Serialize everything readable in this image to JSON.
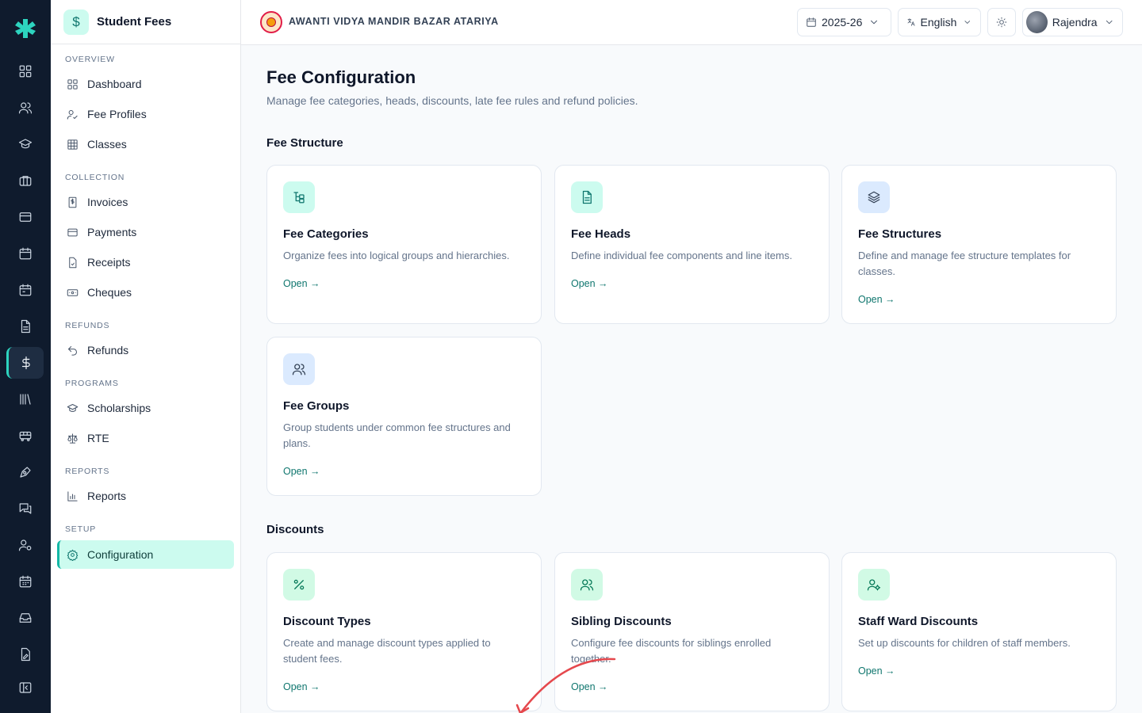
{
  "sidebar": {
    "title": "Student Fees",
    "title_icon": "dollar-icon",
    "sections": [
      {
        "label": "Overview",
        "items": [
          {
            "label": "Dashboard",
            "icon": "grid-icon"
          },
          {
            "label": "Fee Profiles",
            "icon": "user-check-icon"
          },
          {
            "label": "Classes",
            "icon": "table-icon"
          }
        ]
      },
      {
        "label": "Collection",
        "items": [
          {
            "label": "Invoices",
            "icon": "invoice-icon"
          },
          {
            "label": "Payments",
            "icon": "card-icon"
          },
          {
            "label": "Receipts",
            "icon": "receipt-icon"
          },
          {
            "label": "Cheques",
            "icon": "cheque-icon"
          }
        ]
      },
      {
        "label": "Refunds",
        "items": [
          {
            "label": "Refunds",
            "icon": "undo-icon"
          }
        ]
      },
      {
        "label": "Programs",
        "items": [
          {
            "label": "Scholarships",
            "icon": "graduation-cap-icon"
          },
          {
            "label": "RTE",
            "icon": "scale-icon"
          }
        ]
      },
      {
        "label": "Reports",
        "items": [
          {
            "label": "Reports",
            "icon": "bar-chart-icon"
          }
        ]
      },
      {
        "label": "Setup",
        "items": [
          {
            "label": "Configuration",
            "icon": "gear-icon",
            "active": true
          }
        ]
      }
    ]
  },
  "topbar": {
    "school_name": "AWANTI VIDYA MANDIR BAZAR ATARIYA",
    "year": "2025-26",
    "language": "English",
    "user": "Rajendra"
  },
  "page": {
    "title": "Fee Configuration",
    "subtitle": "Manage fee categories, heads, discounts, late fee rules and refund policies.",
    "open_label": "Open →",
    "sections": [
      {
        "title": "Fee Structure",
        "cards": [
          {
            "title": "Fee Categories",
            "desc": "Organize fees into logical groups and hierarchies.",
            "icon": "hierarchy-icon",
            "tone": "teal"
          },
          {
            "title": "Fee Heads",
            "desc": "Define individual fee components and line items.",
            "icon": "document-icon",
            "tone": "teal"
          },
          {
            "title": "Fee Structures",
            "desc": "Define and manage fee structure templates for classes.",
            "icon": "layers-icon",
            "tone": "blue"
          },
          {
            "title": "Fee Groups",
            "desc": "Group students under common fee structures and plans.",
            "icon": "users-icon",
            "tone": "blue"
          }
        ]
      },
      {
        "title": "Discounts",
        "cards": [
          {
            "title": "Discount Types",
            "desc": "Create and manage discount types applied to student fees.",
            "icon": "percent-icon",
            "tone": "green"
          },
          {
            "title": "Sibling Discounts",
            "desc": "Configure fee discounts for siblings enrolled together.",
            "icon": "users-icon",
            "tone": "green"
          },
          {
            "title": "Staff Ward Discounts",
            "desc": "Set up discounts for children of staff members.",
            "icon": "user-gear-icon",
            "tone": "green"
          }
        ]
      }
    ]
  },
  "colors": {
    "accent": "#0f766e",
    "rail": "#0f1b2d",
    "active_bg": "#ccfbef"
  }
}
